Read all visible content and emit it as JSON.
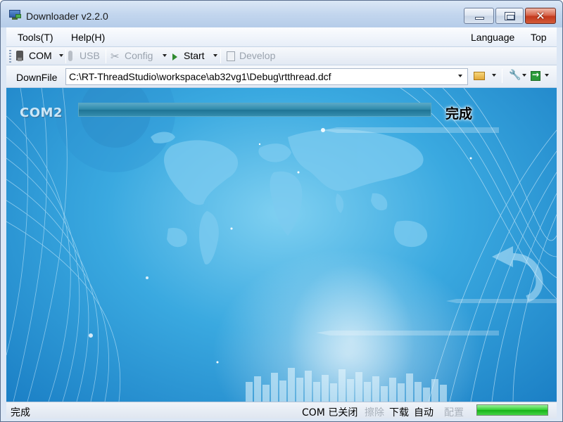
{
  "window": {
    "title": "Downloader v2.2.0",
    "close_glyph": "✕"
  },
  "menu": {
    "tools": "Tools(T)",
    "help": "Help(H)",
    "language": "Language",
    "top": "Top"
  },
  "toolbar": {
    "com": "COM",
    "usb": "USB",
    "config": "Config",
    "start": "Start",
    "develop": "Develop"
  },
  "pathbar": {
    "label": "DownFile",
    "path": "C:\\RT-ThreadStudio\\workspace\\ab32vg1\\Debug\\rtthread.dcf"
  },
  "main": {
    "port_label": "COM2",
    "progress_fraction": 1.0,
    "status_label": "完成"
  },
  "statusbar": {
    "left_text": "完成",
    "com_state": "COM 已关闭",
    "erase": "擦除",
    "download": "下载",
    "auto": "自动",
    "config": "配置",
    "progress_fraction": 1.0
  },
  "colors": {
    "background_accent": "#3aa9e0",
    "status_progress": "#2fd02f"
  }
}
